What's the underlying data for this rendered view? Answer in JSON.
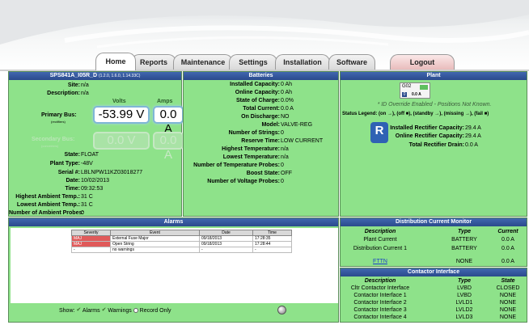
{
  "tabs": [
    "Home",
    "Reports",
    "Maintenance",
    "Settings",
    "Installation",
    "Software",
    "Logout"
  ],
  "system": {
    "title": "SPS841A_I05R_D",
    "version": "(1.2.0, 1.6.0, 1.14.33C)",
    "site_label": "Site:",
    "site": "n/a",
    "desc_label": "Description:",
    "desc": "n/a",
    "volts_label": "Volts",
    "amps_label": "Amps",
    "primary_bus_label": "Primary Bus:",
    "primary_bus_sub": "(rectifiers)",
    "primary_volts": "-53.99 V",
    "primary_amps": "0.0 A",
    "secondary_bus_label": "Secondary Bus:",
    "secondary_bus_sub": "(converters)",
    "secondary_volts": "0.0 V",
    "secondary_amps": "0.0 A",
    "state_label": "State:",
    "state": "FLOAT",
    "plant_type_label": "Plant Type:",
    "plant_type": "-48V",
    "serial_label": "Serial #:",
    "serial": "LBLNPW11KZ03018277",
    "date_label": "Date:",
    "date": "10/02/2013",
    "time_label": "Time:",
    "time": "09:32:53",
    "high_amb_label": "Highest Ambient Temp.:",
    "high_amb": "31 C",
    "low_amb_label": "Lowest Ambient Temp.:",
    "low_amb": "31 C",
    "num_amb_label": "Number of Ambient Probes:",
    "num_amb": "0"
  },
  "batteries": {
    "title": "Batteries",
    "rows": [
      {
        "label": "Installed Capacity:",
        "value": "0 Ah"
      },
      {
        "label": "Online Capacity:",
        "value": "0 Ah"
      },
      {
        "label": "State of Charge:",
        "value": "0.0%"
      },
      {
        "label": "Total Current:",
        "value": "0.0 A"
      },
      {
        "label": "On Discharge:",
        "value": "NO"
      },
      {
        "label": "Model:",
        "value": "VALVE-REG"
      },
      {
        "label": "Number of Strings:",
        "value": "0"
      },
      {
        "label": "Reserve Time:",
        "value": "LOW CURRENT"
      },
      {
        "label": "Highest Temperature:",
        "value": "n/a"
      },
      {
        "label": "Lowest Temperature:",
        "value": "n/a"
      },
      {
        "label": "Number of Temperature Probes:",
        "value": "0"
      },
      {
        "label": "Boost State:",
        "value": "OFF"
      },
      {
        "label": "Number of Voltage Probes:",
        "value": "0"
      }
    ]
  },
  "plant": {
    "title": "Plant",
    "rect_id": "G02",
    "rect_num": "0",
    "rect_amps": "0.0 A",
    "id_override": "* ID Override Enabled - Positions Not Known.",
    "legend": "Status Legend: (on →), (off ■), (standby →), (missing →), (fail ■)",
    "logo_letter": "R",
    "installed_label": "Installed Rectifier Capacity:",
    "installed": "29.4 A",
    "online_label": "Online Rectifier Capacity:",
    "online": "29.4 A",
    "drain_label": "Total Rectifier Drain:",
    "drain": "0.0 A"
  },
  "alarms": {
    "title": "Alarms",
    "headers": [
      "Severity",
      "Event",
      "Date",
      "Time"
    ],
    "rows": [
      {
        "severity": "MAJ",
        "event": "External Fuse Major",
        "date": "09/18/2013",
        "time": "17:28:35"
      },
      {
        "severity": "MAJ",
        "event": "Open String",
        "date": "09/18/2013",
        "time": "17:28:44"
      },
      {
        "severity": "-",
        "event": "no warnings",
        "date": "-",
        "time": "-"
      }
    ],
    "show_label": "Show:",
    "filter_alarms": "Alarms",
    "filter_warnings": "Warnings",
    "filter_record": "Record Only"
  },
  "distribution": {
    "title": "Distribution Current Monitor",
    "headers": [
      "Description",
      "Type",
      "Current"
    ],
    "rows": [
      {
        "desc": "Plant Current",
        "type": "BATTERY",
        "current": "0.0 A"
      },
      {
        "desc": "Distribution Current 1",
        "type": "BATTERY",
        "current": "0.0 A"
      }
    ],
    "link_row": {
      "desc": "FTTN",
      "type": "NONE",
      "current": "0.0 A"
    }
  },
  "contactor": {
    "title": "Contactor Interface",
    "headers": [
      "Description",
      "Type",
      "State"
    ],
    "rows": [
      {
        "desc": "Cltr Contactor Interface",
        "type": "LVBD",
        "state": "CLOSED"
      },
      {
        "desc": "Contactor Interface 1",
        "type": "LVBD",
        "state": "NONE"
      },
      {
        "desc": "Contactor Interface 2",
        "type": "LVLD1",
        "state": "NONE"
      },
      {
        "desc": "Contactor Interface 3",
        "type": "LVLD2",
        "state": "NONE"
      },
      {
        "desc": "Contactor Interface 4",
        "type": "LVLD3",
        "state": "NONE"
      }
    ]
  },
  "colors": {
    "panel_green": "#8ee28a",
    "title_blue": "#2a4a8c",
    "major_red": "#e05a5a"
  }
}
